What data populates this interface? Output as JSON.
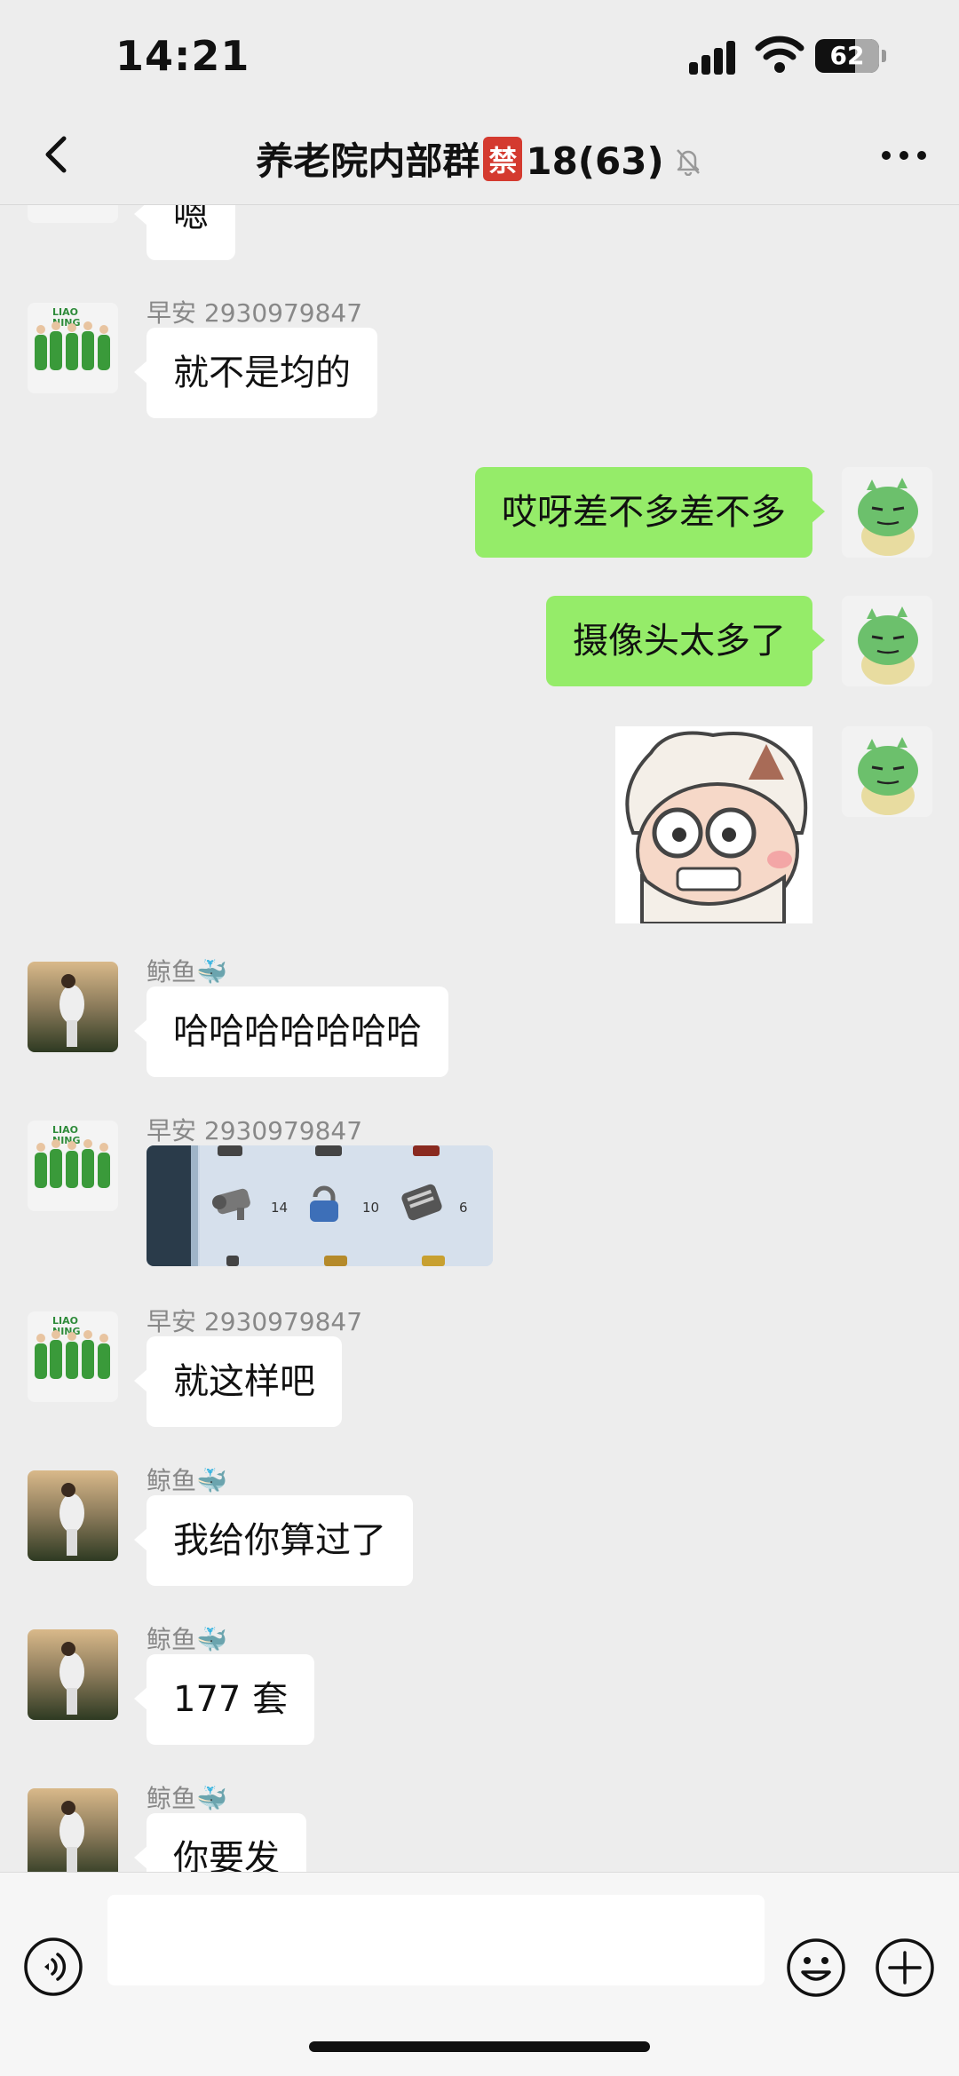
{
  "status": {
    "time": "14:21",
    "battery": "62",
    "battery_level": 0.62
  },
  "nav": {
    "title": "养老院内部群",
    "badge": "禁",
    "count": "18(63)"
  },
  "messages": [
    {
      "sender": "",
      "text": "嗯"
    },
    {
      "sender": "早安 2930979847",
      "text": "就不是均的"
    },
    {
      "text": "哎呀差不多差不多"
    },
    {
      "text": "摄像头太多了"
    },
    {
      "sender": "鲸鱼🐳",
      "text": "哈哈哈哈哈哈哈"
    },
    {
      "sender": "早安 2930979847",
      "image_labels": [
        "14",
        "10",
        "6"
      ]
    },
    {
      "sender": "早安 2930979847",
      "text": "就这样吧"
    },
    {
      "sender": "鲸鱼🐳",
      "text": "我给你算过了"
    },
    {
      "sender": "鲸鱼🐳",
      "text": "177 套"
    },
    {
      "sender": "鲸鱼🐳",
      "text": "你要发"
    }
  ],
  "colors": {
    "outgoing_bubble": "#95ec69",
    "incoming_bubble": "#ffffff",
    "background": "#ededed",
    "mute_badge": "#d43a2f"
  },
  "icons": [
    "back-icon",
    "mute-bell-icon",
    "more-icon",
    "voice-icon",
    "emoji-icon",
    "plus-icon"
  ]
}
